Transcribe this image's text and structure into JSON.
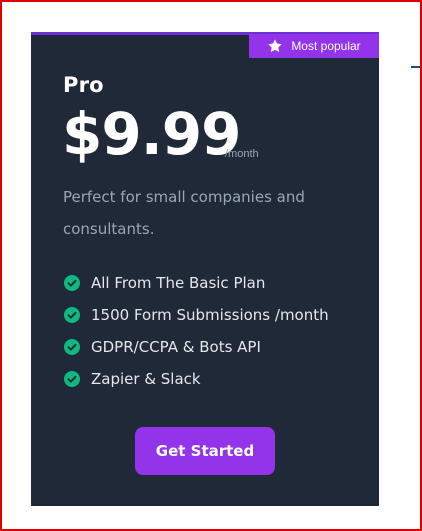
{
  "card": {
    "badge": {
      "label": "Most popular",
      "icon": "star-icon"
    },
    "plan_name": "Pro",
    "price": "$9.99",
    "period": "/month",
    "description": "Perfect for small companies and consultants.",
    "features": [
      {
        "label": "All From The Basic Plan",
        "icon": "check-circle-icon"
      },
      {
        "label": "1500 Form Submissions /month",
        "icon": "check-circle-icon"
      },
      {
        "label": "GDPR/CCPA & Bots API",
        "icon": "check-circle-icon"
      },
      {
        "label": "Zapier & Slack",
        "icon": "check-circle-icon"
      }
    ],
    "cta_label": "Get Started"
  },
  "colors": {
    "card_background": "#1f2937",
    "accent": "#9333ea",
    "check": "#10b981",
    "frame_border": "#e00000"
  }
}
